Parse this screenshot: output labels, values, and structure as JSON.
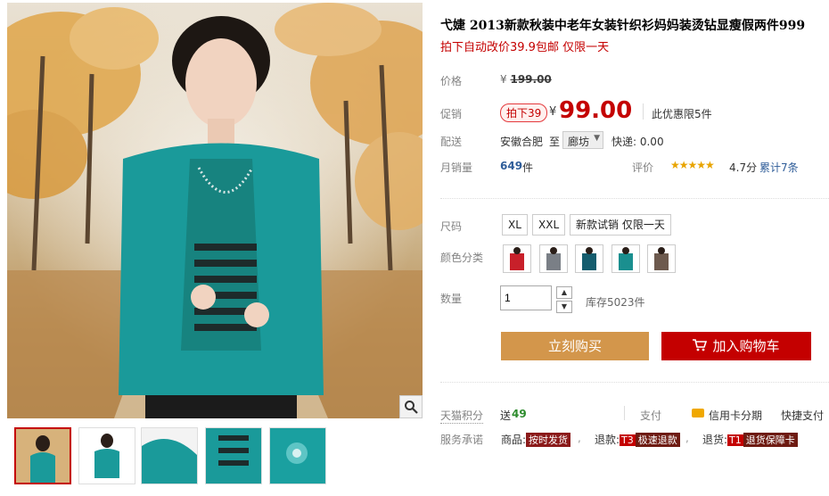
{
  "product": {
    "title": "弋婕 2013新款秋装中老年女装针织衫妈妈装烫钻显瘦假两件999",
    "subtitle": "拍下自动改价39.9包邮 仅限一天"
  },
  "price": {
    "label": "价格",
    "currency": "¥",
    "original": "199.00",
    "promo_label": "促销",
    "promo_tag": "拍下39",
    "current": "99.00",
    "promo_note": "此优惠限5件"
  },
  "shipping": {
    "label": "配送",
    "from": "安徽合肥",
    "to_word": "至",
    "to": "廊坊",
    "express": "快递: 0.00"
  },
  "sales": {
    "label": "月销量",
    "count": "649",
    "unit": "件",
    "rating_label": "评价",
    "stars": "★★★★★",
    "score": "4.7分",
    "reviews": "累计7条"
  },
  "sku": {
    "size_label": "尺码",
    "sizes": [
      "XL",
      "XXL",
      "新款试销 仅限一天"
    ],
    "color_label": "颜色分类",
    "colors": [
      "#c8202a",
      "#7a7f86",
      "#155d6e",
      "#1a8f8f",
      "#6d5a4e"
    ]
  },
  "quantity": {
    "label": "数量",
    "value": "1",
    "stock": "库存5023件"
  },
  "actions": {
    "buy": "立刻购买",
    "cart": "加入购物车"
  },
  "points": {
    "label": "天猫积分",
    "prefix": "送",
    "value": "49",
    "pay_label": "支付",
    "credit": "信用卡分期",
    "quick": "快捷支付"
  },
  "service": {
    "label": "服务承诺",
    "goods_label": "商品:",
    "goods_badge": "按时发货",
    "refund_label": "退款:",
    "refund_tag": "T3",
    "refund_badge": "极速退款",
    "return_label": "退货:",
    "return_tag": "T1",
    "return_badge": "退货保障卡"
  },
  "colors": {
    "accent": "#c40000",
    "buy_button": "#d3964b",
    "cardigan": "#1a9a9a"
  }
}
